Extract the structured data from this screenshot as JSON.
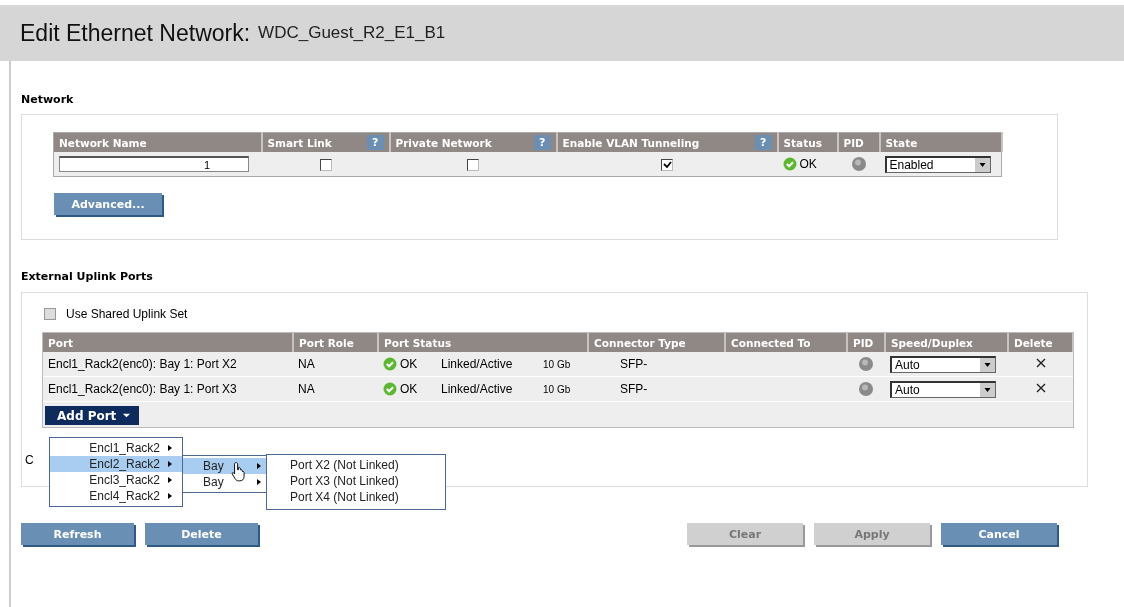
{
  "page": {
    "title": "Edit Ethernet Network:",
    "network_name": "WDC_Guest_R2_E1_B1"
  },
  "network": {
    "heading": "Network",
    "columns": [
      {
        "label": "Network Name"
      },
      {
        "label": "Smart Link",
        "help": "?"
      },
      {
        "label": "Private Network",
        "help": "?"
      },
      {
        "label": "Enable VLAN Tunneling",
        "help": "?"
      },
      {
        "label": "Status"
      },
      {
        "label": "PID"
      },
      {
        "label": "State"
      }
    ],
    "row": {
      "name_value": "1",
      "smart_link_checked": false,
      "private_checked": false,
      "vlan_checked": true,
      "status": "OK",
      "state": "Enabled"
    },
    "advanced_button": "Advanced..."
  },
  "uplinks": {
    "heading": "External Uplink Ports",
    "use_shared": {
      "label": "Use Shared Uplink Set",
      "checked": false,
      "disabled": true
    },
    "columns": [
      {
        "label": "Port"
      },
      {
        "label": "Port Role"
      },
      {
        "label": "Port Status"
      },
      {
        "label": "Connector Type"
      },
      {
        "label": "Connected To"
      },
      {
        "label": "PID"
      },
      {
        "label": "Speed/Duplex"
      },
      {
        "label": "Delete"
      }
    ],
    "rows": [
      {
        "port": "Encl1_Rack2(enc0): Bay 1: Port X2",
        "role": "NA",
        "status": "OK",
        "link": "Linked/Active",
        "speed": "10 Gb",
        "connector": "SFP-",
        "speed_duplex": "Auto"
      },
      {
        "port": "Encl1_Rack2(enc0): Bay 1: Port X3",
        "role": "NA",
        "status": "OK",
        "link": "Linked/Active",
        "speed": "10 Gb",
        "connector": "SFP-",
        "speed_duplex": "Auto"
      }
    ],
    "add_port": "Add Port",
    "partial_text": "C",
    "menu": {
      "items": [
        {
          "label": "Encl1_Rack2",
          "selected": false
        },
        {
          "label": "Encl2_Rack2",
          "selected": true
        },
        {
          "label": "Encl3_Rack2",
          "selected": false
        },
        {
          "label": "Encl4_Rack2",
          "selected": false
        }
      ],
      "bays": [
        {
          "label": "Bay",
          "selected": true
        },
        {
          "label": "Bay",
          "selected": false
        }
      ],
      "ports": [
        "Port X2 (Not Linked)",
        "Port X3 (Not Linked)",
        "Port X4 (Not Linked)"
      ]
    }
  },
  "buttons": [
    {
      "label": "Refresh",
      "disabled": false,
      "kind": "left"
    },
    {
      "label": "Delete",
      "disabled": false,
      "kind": "left"
    },
    {
      "label": "Clear",
      "disabled": true,
      "kind": "right"
    },
    {
      "label": "Apply",
      "disabled": true,
      "kind": "right"
    },
    {
      "label": "Cancel",
      "disabled": false,
      "kind": "right"
    }
  ]
}
